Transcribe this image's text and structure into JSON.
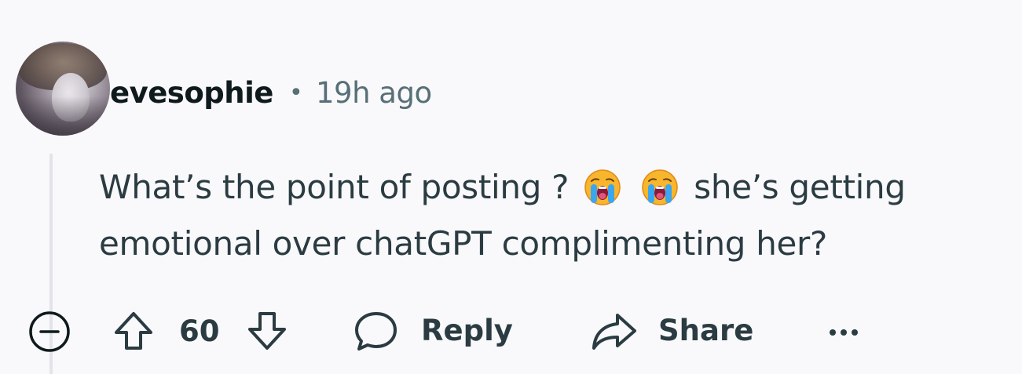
{
  "comment": {
    "author": "evesophie",
    "separator": "•",
    "timestamp": "19h ago",
    "text_part1": "What’s the point of posting ?",
    "text_part2": "she’s getting emotional over chatGPT complimenting her?",
    "emoji_name": "loudly-crying-face"
  },
  "actions": {
    "score": "60",
    "reply_label": "Reply",
    "share_label": "Share"
  },
  "icons": {
    "collapse": "minus-circle-icon",
    "upvote": "upvote-arrow-icon",
    "downvote": "downvote-arrow-icon",
    "reply": "speech-bubble-icon",
    "share": "share-arrow-icon",
    "more": "ellipsis-icon"
  },
  "colors": {
    "background": "#f9f8fb",
    "text": "#2a3c42",
    "username": "#0f1a1c",
    "meta": "#576f76",
    "thread_line": "#e3e3ea"
  }
}
